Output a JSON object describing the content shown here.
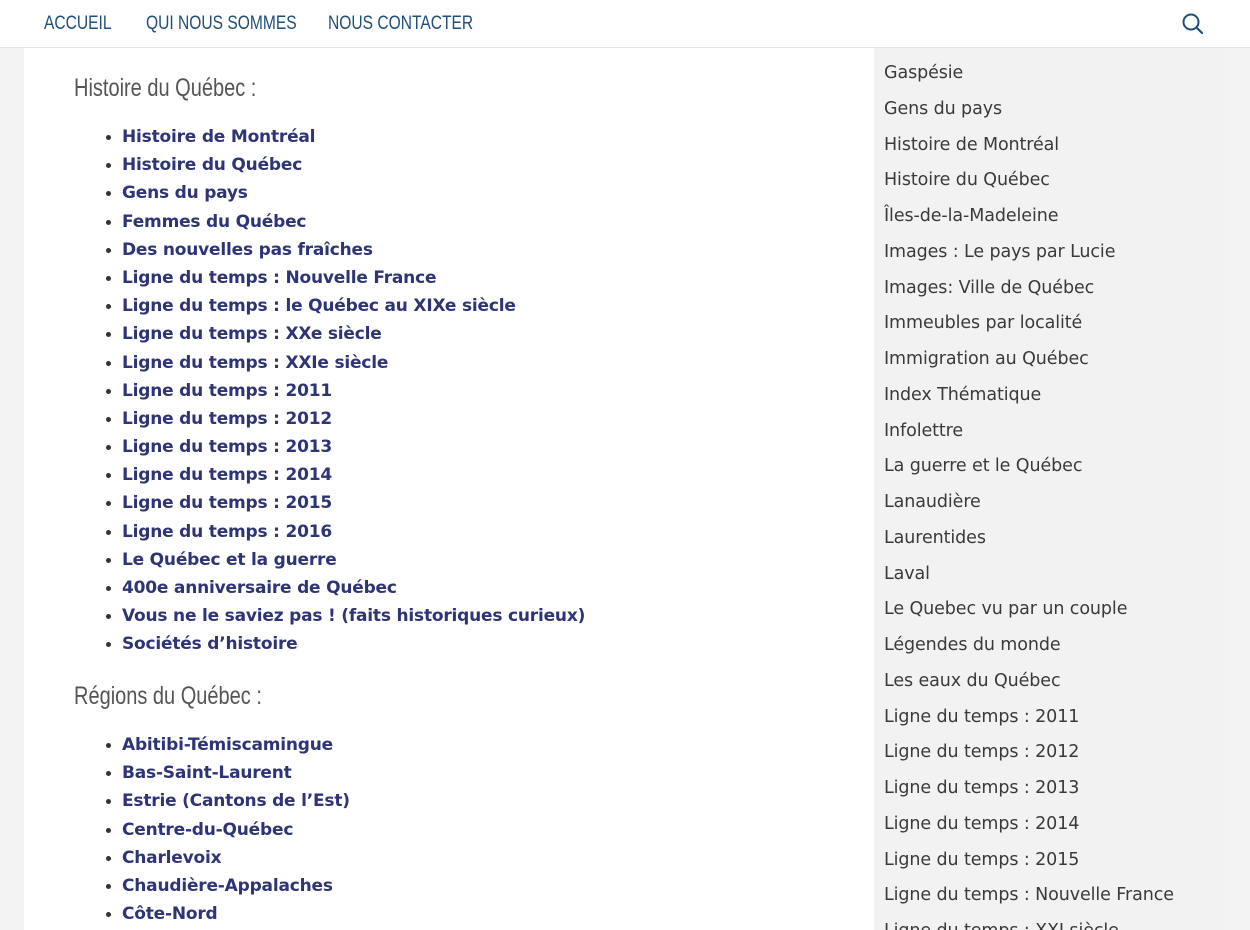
{
  "nav": {
    "items": [
      "ACCUEIL",
      "QUI NOUS SOMMES",
      "NOUS CONTACTER"
    ],
    "search_icon": "search-icon"
  },
  "colors": {
    "nav_link": "#1f4e79",
    "content_link": "#2e3475",
    "sidebar_bg": "#f2f2f2",
    "heading": "#555555"
  },
  "main": {
    "history": {
      "title": "Histoire du Québec :",
      "links": [
        "Histoire de Montréal",
        "Histoire du Québec",
        "Gens du pays",
        "Femmes du Québec",
        "Des nouvelles pas fraîches",
        "Ligne du temps : Nouvelle France",
        "Ligne du temps : le Québec au XIXe siècle",
        "Ligne du temps : XXe siècle",
        "Ligne du temps : XXIe siècle",
        "Ligne du temps : 2011",
        "Ligne du temps : 2012",
        "Ligne du temps : 2013",
        "Ligne du temps : 2014",
        "Ligne du temps : 2015",
        "Ligne du temps : 2016",
        "Le Québec et la guerre",
        "400e anniversaire de Québec",
        "Vous ne le saviez pas ! (faits historiques curieux)",
        "Sociétés d’histoire"
      ]
    },
    "regions": {
      "title": "Régions du Québec :",
      "links": [
        "Abitibi-Témiscamingue",
        "Bas-Saint-Laurent",
        "Estrie (Cantons de l’Est)",
        "Centre-du-Québec",
        "Charlevoix",
        "Chaudière-Appalaches",
        "Côte-Nord"
      ]
    }
  },
  "sidebar": {
    "items": [
      "Gaspésie",
      "Gens du pays",
      "Histoire de Montréal",
      "Histoire du Québec",
      "Îles-de-la-Madeleine",
      "Images : Le pays par Lucie",
      "Images: Ville de Québec",
      "Immeubles par localité",
      "Immigration au Québec",
      "Index Thématique",
      "Infolettre",
      "La guerre et le Québec",
      "Lanaudière",
      "Laurentides",
      "Laval",
      "Le Quebec vu par un couple",
      "Légendes du monde",
      "Les eaux du Québec",
      "Ligne du temps : 2011",
      "Ligne du temps : 2012",
      "Ligne du temps : 2013",
      "Ligne du temps : 2014",
      "Ligne du temps : 2015",
      "Ligne du temps : Nouvelle France",
      "Ligne du temps : XXI siècle"
    ]
  }
}
